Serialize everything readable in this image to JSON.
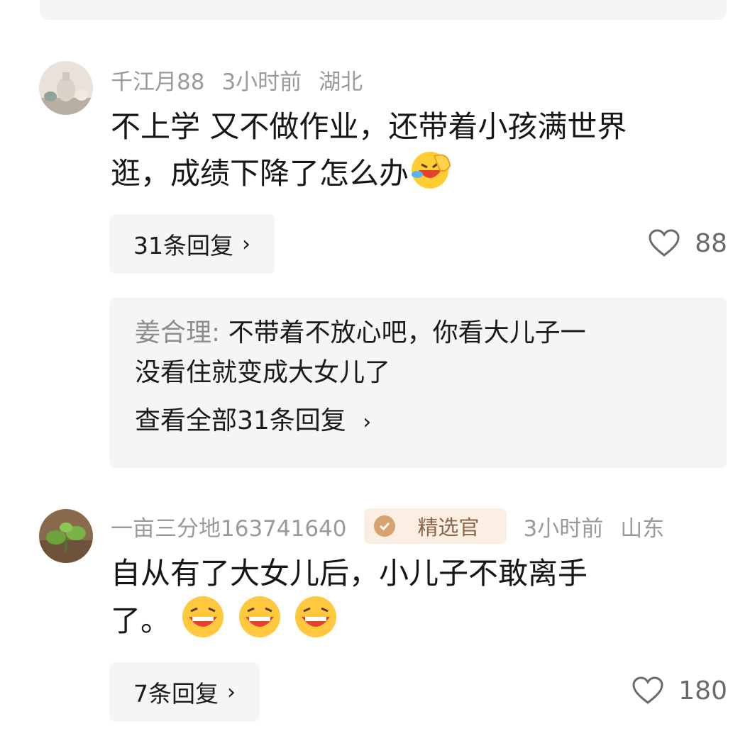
{
  "comments": [
    {
      "username": "千江月88",
      "time": "3小时前",
      "location": "湖北",
      "text_line1": "不上学 又不做作业，还带着小孩满世界",
      "text_line2": "逛，成绩下降了怎么办",
      "emoji": "rolling-laugh-emoji",
      "reply_count_label": "31条回复",
      "likes": "88",
      "top_reply": {
        "author": "姜合理",
        "separator": ": ",
        "text_line1": "不带着不放心吧，你看大儿子一",
        "text_line2": "没看住就变成大女儿了",
        "view_all_label": "查看全部31条回复"
      }
    },
    {
      "username": "一亩三分地163741640",
      "badge": "精选官",
      "time": "3小时前",
      "location": "山东",
      "text_line1": "自从有了大女儿后，小儿子不敢离手",
      "text_line2": "了。",
      "emoji": "grinning-emoji",
      "reply_count_label": "7条回复",
      "likes": "180"
    }
  ],
  "colors": {
    "background": "#ffffff",
    "panel": "#f5f5f5",
    "meta_text": "#9a9a9a",
    "badge_bg": "#fbefe4"
  }
}
